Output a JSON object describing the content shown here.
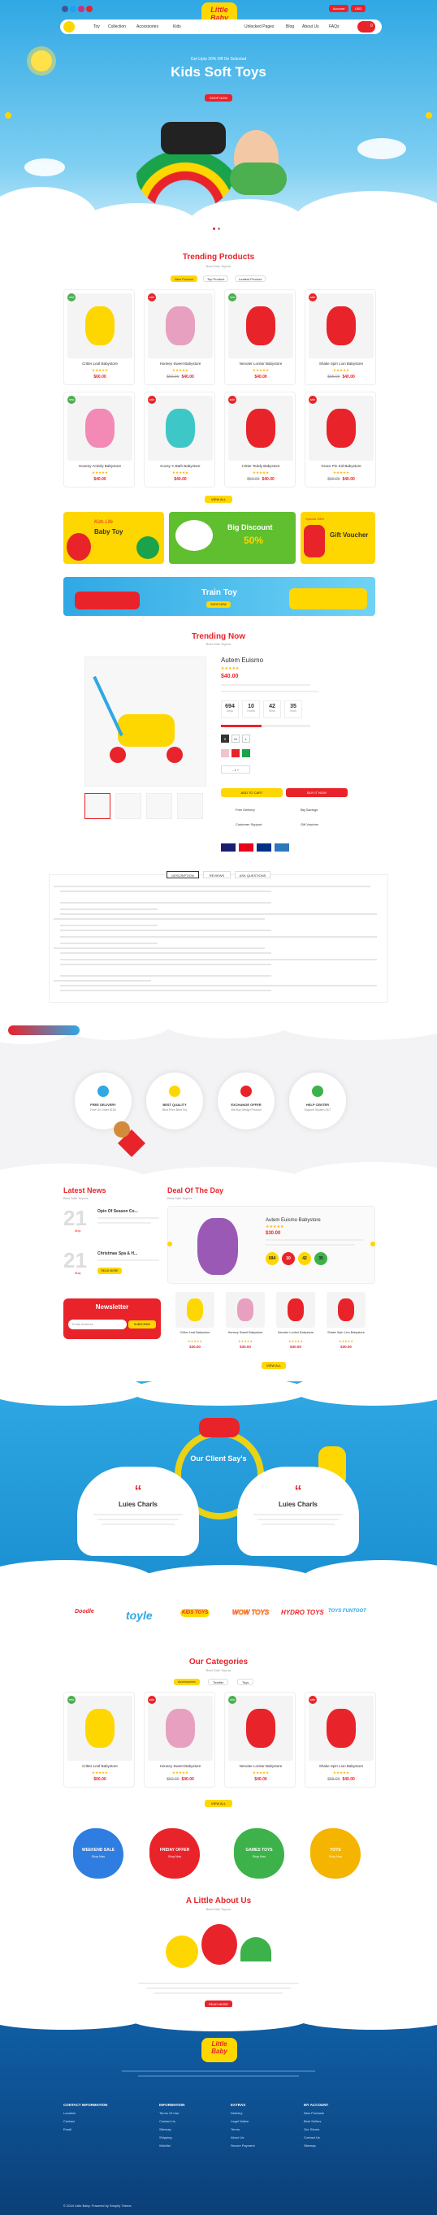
{
  "colors": {
    "brand_red": "#e8242a",
    "brand_yellow": "#ffd700",
    "sky": "#2fa8e4",
    "footer": "#0f5fa6"
  },
  "header": {
    "logo_line1": "Little",
    "logo_line2": "Baby",
    "nav": [
      "Toy",
      "Collection",
      "Accessories",
      "Kids",
      "Unlocked Pages",
      "Blog",
      "About Us",
      "FAQs"
    ],
    "account": "Account",
    "currency": "USD",
    "cart_count": "0"
  },
  "hero": {
    "promo": "Get Upto 20% Off On Selected",
    "title": "Kids Soft Toys",
    "cta": "SHOP NOW"
  },
  "trending": {
    "title": "Trending Products",
    "subtitle": "Best Sale Toycos",
    "tabs": [
      "New Product",
      "Top Product",
      "Leatest Product"
    ],
    "products": [
      {
        "name": "Critter Leaf Babystore",
        "price": "$60.00",
        "old": "",
        "badge": "new"
      },
      {
        "name": "Honeey Sweet Babystore",
        "price": "$40.00",
        "old": "$50.00",
        "badge": "sale"
      },
      {
        "name": "Nenoter Lonitor Babystore",
        "price": "$40.00",
        "old": "",
        "badge": "new"
      },
      {
        "name": "Shake Spin Lion Babystore",
        "price": "$40.00",
        "old": "$55.00",
        "badge": "sale"
      },
      {
        "name": "Honeey Activity Babystore",
        "price": "$40.00",
        "old": "",
        "badge": "new"
      },
      {
        "name": "Koosy 'n Bath Babystore",
        "price": "$40.00",
        "old": "",
        "badge": "sale"
      },
      {
        "name": "Critter Teddy Babystore",
        "price": "$40.00",
        "old": "$50.00",
        "badge": "sale"
      },
      {
        "name": "Grace Pin Kid Babystore",
        "price": "$40.00",
        "old": "$50.00",
        "badge": "sale"
      }
    ],
    "view_all": "VIEW ALL"
  },
  "banners": {
    "b1_title": "Baby Toy",
    "b1_sub": "Kids Life",
    "b2_title": "Big Discount",
    "b2_pct": "50%",
    "b3_title": "Gift Voucher",
    "b3_sub": "Special Offer",
    "train": "Train Toy",
    "train_cta": "SHOP NOW"
  },
  "trending_now": {
    "title": "Trending Now",
    "subtitle": "Best Sale Toycos",
    "product": "Autem Euismo",
    "price": "$40.00",
    "countdown": [
      {
        "v": "694",
        "l": "Days"
      },
      {
        "v": "10",
        "l": "Hours"
      },
      {
        "v": "42",
        "l": "Mins"
      },
      {
        "v": "35",
        "l": "Secs"
      }
    ],
    "add_cart": "ADD TO CART",
    "buy": "BUY IT NOW",
    "sizes": [
      "S",
      "M",
      "L"
    ],
    "perks": [
      "Free Delivery",
      "Big Savings",
      "Customer Support",
      "Gift Voucher"
    ]
  },
  "desc_tabs": [
    "DESCRIPTION",
    "REVIEWS",
    "ASK QUESTIONS"
  ],
  "features": [
    {
      "t": "FREE DELIVERY",
      "s": "Free On Order $150"
    },
    {
      "t": "BEST QUALITY",
      "s": "Best Price Best Toy"
    },
    {
      "t": "EXCHANGE OFFER",
      "s": "We Buy Design Product"
    },
    {
      "t": "HELP CENTER",
      "s": "Support System 24/7"
    }
  ],
  "news": {
    "title": "Latest News",
    "subtitle": "Best Sale Toycos",
    "items": [
      {
        "d": "21",
        "m": "May",
        "t": "Opin Of Season Co..."
      },
      {
        "d": "21",
        "m": "May",
        "t": "Christmas Spa & H..."
      }
    ],
    "read_more": "READ MORE"
  },
  "newsletter": {
    "title": "Newsletter",
    "placeholder": "Email Address",
    "cta": "SUBSCRIBE"
  },
  "deal": {
    "title": "Deal Of The Day",
    "subtitle": "Best Sale Toycos",
    "product": "Autem Euismo Babystore",
    "price": "$30.00",
    "countdown": [
      "694",
      "10",
      "42",
      "35"
    ],
    "mini": [
      {
        "n": "Critter Leaf Babystore",
        "p": "$30.00"
      },
      {
        "n": "Honeey Sweet Babystore",
        "p": "$30.00"
      },
      {
        "n": "Nenoter Lonitor Babystore",
        "p": "$30.00"
      },
      {
        "n": "Shake Spin Lion Babystore",
        "p": "$30.00"
      }
    ],
    "view_all": "VIEW ALL"
  },
  "testimonials": {
    "title": "Our Client Say's",
    "items": [
      {
        "name": "Luies Charls"
      },
      {
        "name": "Luies Charls"
      }
    ]
  },
  "brands": [
    "Doodle",
    "toyle",
    "KIDS TOYS",
    "WOW TOYS",
    "HYDRO TOYS",
    "TOYS FUNTOOT"
  ],
  "categories": {
    "title": "Our Categories",
    "subtitle": "Best Sale Toycos",
    "tabs": [
      "Accessories",
      "Toddler",
      "Toys"
    ],
    "view_all": "VIEW ALL"
  },
  "promos": [
    {
      "t": "WEEKEND SALE",
      "s": "Shop Now"
    },
    {
      "t": "FRIDAY OFFER",
      "s": "Shop Now"
    },
    {
      "t": "GAMES TOYS",
      "s": "Shop Now"
    },
    {
      "t": "TOYS",
      "s": "Shop Now"
    }
  ],
  "about": {
    "title": "A Little About Us",
    "subtitle": "Best Sale Toycos",
    "cta": "READ MORE"
  },
  "footer": {
    "logo_line1": "Little",
    "logo_line2": "Baby",
    "cols": [
      {
        "h": "CONTACT INFORMATION",
        "i": [
          "Location",
          "Contact",
          "Email"
        ]
      },
      {
        "h": "INFORMATION",
        "i": [
          "Terms Of Use",
          "Contact Us",
          "Sitemap",
          "Shipping",
          "Wishlist"
        ]
      },
      {
        "h": "EXTRAS",
        "i": [
          "Delivery",
          "Legal Notice",
          "Terms",
          "About Us",
          "Secure Payment"
        ]
      },
      {
        "h": "MY ACCOUNT",
        "i": [
          "New Products",
          "Best Sellers",
          "Our Stores",
          "Contact Us",
          "Sitemap"
        ]
      }
    ],
    "copyright": "© 2024 Little Baby. Powered by Shopify Theme"
  }
}
